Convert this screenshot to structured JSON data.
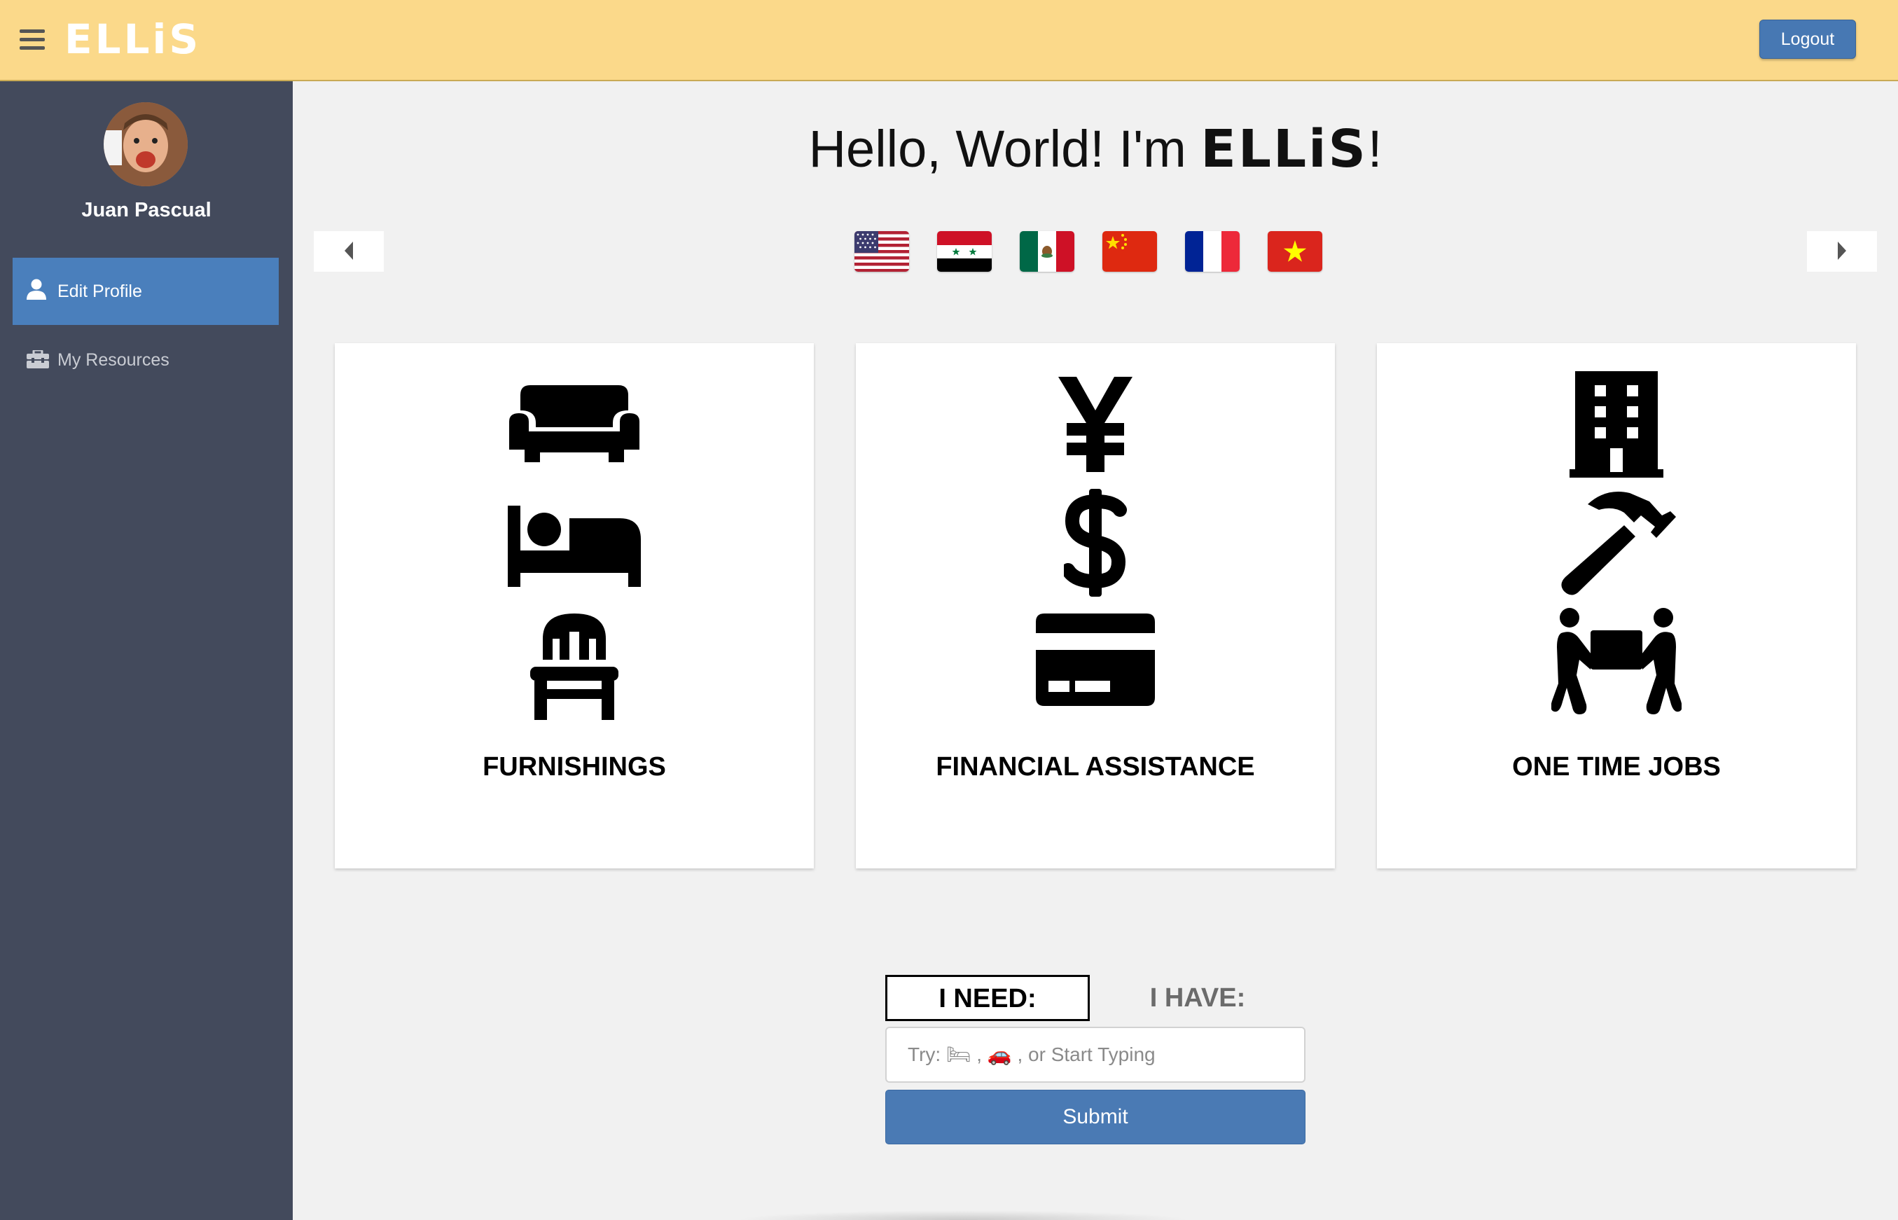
{
  "header": {
    "logo": "ELLiS",
    "logout_label": "Logout"
  },
  "sidebar": {
    "user_name": "Juan Pascual",
    "items": [
      {
        "label": "Edit Profile",
        "icon": "user-icon"
      },
      {
        "label": "My Resources",
        "icon": "toolbox-icon"
      }
    ]
  },
  "main": {
    "greeting": "Hello, World! I'm ",
    "greeting_brand": "ELLiS",
    "greeting_end": "!",
    "languages": [
      {
        "icon": "us-flag-icon"
      },
      {
        "icon": "syria-flag-icon"
      },
      {
        "icon": "mexico-flag-icon"
      },
      {
        "icon": "china-flag-icon"
      },
      {
        "icon": "france-flag-icon"
      },
      {
        "icon": "vietnam-flag-icon"
      }
    ],
    "categories": [
      {
        "title": "FURNISHINGS",
        "icons": [
          "couch-icon",
          "bed-icon",
          "chair-icon"
        ]
      },
      {
        "title": "FINANCIAL ASSISTANCE",
        "icons": [
          "yen-icon",
          "dollar-icon",
          "credit-card-icon"
        ]
      },
      {
        "title": "ONE TIME JOBS",
        "icons": [
          "building-icon",
          "hammer-icon",
          "people-carry-icon"
        ]
      }
    ],
    "form": {
      "tab_need": "I NEED:",
      "tab_have": "I HAVE:",
      "placeholder": "Try: 🛏 , 🚗 , or Start Typing",
      "submit_label": "Submit"
    }
  },
  "colors": {
    "header_bg": "#fbd98a",
    "sidebar_bg": "#434a5c",
    "accent": "#4a7ab4"
  }
}
